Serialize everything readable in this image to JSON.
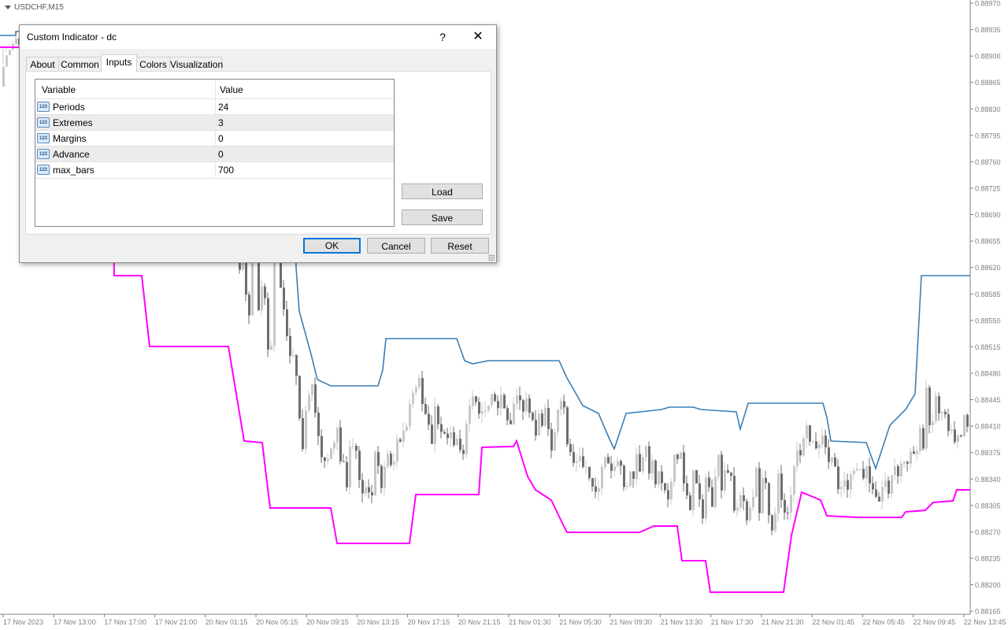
{
  "chart": {
    "symbol": "USDCHF,M15",
    "price_labels": [
      "0.88970",
      "0.88935",
      "0.88900",
      "0.88865",
      "0.88830",
      "0.88795",
      "0.88760",
      "0.88725",
      "0.88690",
      "0.88655",
      "0.88620",
      "0.88585",
      "0.88550",
      "0.88515",
      "0.88480",
      "0.88445",
      "0.88410",
      "0.88375",
      "0.88340",
      "0.88305",
      "0.88270",
      "0.88235",
      "0.88200",
      "0.88165"
    ],
    "time_labels": [
      "17 Nov 2023",
      "17 Nov 13:00",
      "17 Nov 17:00",
      "17 Nov 21:00",
      "20 Nov 01:15",
      "20 Nov 05:15",
      "20 Nov 09:15",
      "20 Nov 13:15",
      "20 Nov 17:15",
      "20 Nov 21:15",
      "21 Nov 01:30",
      "21 Nov 05:30",
      "21 Nov 09:30",
      "21 Nov 13:30",
      "21 Nov 17:30",
      "21 Nov 21:30",
      "22 Nov 01:45",
      "22 Nov 05:45",
      "22 Nov 09:45",
      "22 Nov 13:45"
    ],
    "colors": {
      "upper_band": "#3a7fb5",
      "lower_band": "#ff00ff",
      "bull_candle": "#c8c8c8",
      "bear_candle": "#6e6e6e",
      "axis": "#808080"
    }
  },
  "dialog": {
    "title": "Custom Indicator - dc",
    "help_glyph": "?",
    "close_glyph": "✕",
    "tabs": [
      {
        "label": "About"
      },
      {
        "label": "Common"
      },
      {
        "label": "Inputs"
      },
      {
        "label": "Colors"
      },
      {
        "label": "Visualization"
      }
    ],
    "active_tab": "Inputs",
    "table": {
      "headers": {
        "variable": "Variable",
        "value": "Value"
      },
      "rows": [
        {
          "name": "Periods",
          "value": "24"
        },
        {
          "name": "Extremes",
          "value": "3"
        },
        {
          "name": "Margins",
          "value": "0"
        },
        {
          "name": "Advance",
          "value": "0"
        },
        {
          "name": "max_bars",
          "value": "700"
        }
      ],
      "row_icon": "123"
    },
    "buttons": {
      "load": "Load",
      "save": "Save",
      "ok": "OK",
      "cancel": "Cancel",
      "reset": "Reset"
    }
  }
}
